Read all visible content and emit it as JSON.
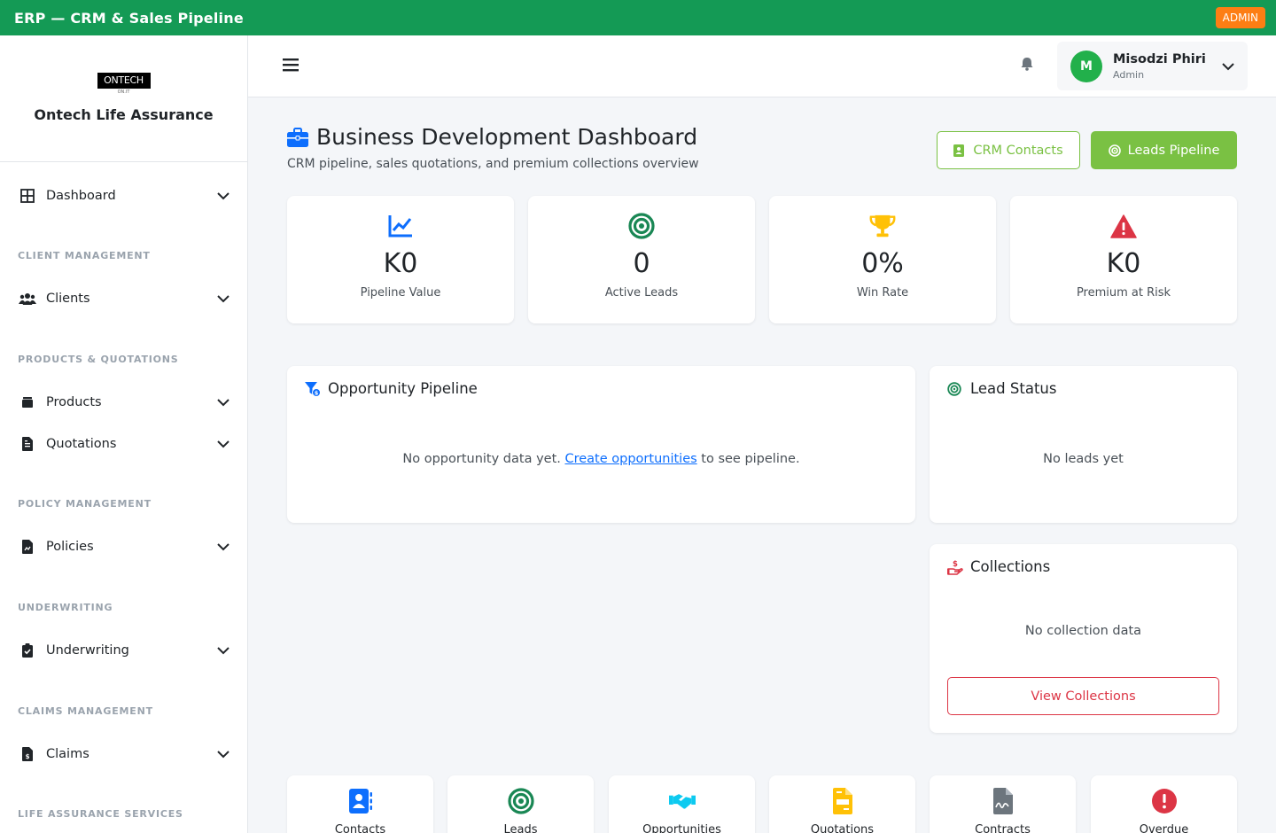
{
  "topbar": {
    "title": "ERP — CRM & Sales Pipeline",
    "badge": "ADMIN"
  },
  "sidebar": {
    "logo_text": "ONTECH",
    "logo_sub": "ON.IT",
    "company": "Ontech Life Assurance",
    "items": [
      {
        "label": "Dashboard",
        "icon": "grid-icon"
      },
      {
        "label": "Clients",
        "icon": "users-icon"
      },
      {
        "label": "Products",
        "icon": "box-icon"
      },
      {
        "label": "Quotations",
        "icon": "document-icon"
      },
      {
        "label": "Policies",
        "icon": "policy-file-icon"
      },
      {
        "label": "Underwriting",
        "icon": "clipboard-check-icon"
      },
      {
        "label": "Claims",
        "icon": "invoice-icon"
      }
    ],
    "sections": [
      "CLIENT MANAGEMENT",
      "PRODUCTS & QUOTATIONS",
      "POLICY MANAGEMENT",
      "UNDERWRITING",
      "CLAIMS MANAGEMENT",
      "LIFE ASSURANCE SERVICES"
    ]
  },
  "header": {
    "user": {
      "initial": "M",
      "name": "Misodzi Phiri",
      "role": "Admin"
    }
  },
  "main": {
    "title": "Business Development Dashboard",
    "subtitle": "CRM pipeline, sales quotations, and premium collections overview",
    "buttons": {
      "crm_contacts": "CRM Contacts",
      "leads_pipeline": "Leads Pipeline"
    },
    "stats": [
      {
        "value": "K0",
        "label": "Pipeline Value",
        "icon": "chart-line-icon",
        "color": "#0d6efd"
      },
      {
        "value": "0",
        "label": "Active Leads",
        "icon": "target-icon",
        "color": "#198754"
      },
      {
        "value": "0%",
        "label": "Win Rate",
        "icon": "trophy-icon",
        "color": "#ffc107"
      },
      {
        "value": "K0",
        "label": "Premium at Risk",
        "icon": "warning-icon",
        "color": "#dc3545"
      }
    ],
    "opportunity": {
      "title": "Opportunity Pipeline",
      "empty_prefix": "No opportunity data yet.",
      "empty_link": "Create opportunities",
      "empty_suffix": "to see pipeline."
    },
    "lead_status": {
      "title": "Lead Status",
      "empty": "No leads yet"
    },
    "collections": {
      "title": "Collections",
      "empty": "No collection data",
      "button": "View Collections"
    },
    "quick_links": [
      {
        "label": "Contacts",
        "icon": "contact-book-icon",
        "color": "#0d6efd"
      },
      {
        "label": "Leads",
        "icon": "target-icon",
        "color": "#198754"
      },
      {
        "label": "Opportunities",
        "icon": "handshake-icon",
        "color": "#0dcaf0"
      },
      {
        "label": "Quotations",
        "icon": "file-invoice-icon",
        "color": "#ffc107"
      },
      {
        "label": "Contracts",
        "icon": "file-signature-icon",
        "color": "#6c757d"
      },
      {
        "label": "Overdue",
        "icon": "exclamation-circle-icon",
        "color": "#dc3545"
      }
    ]
  }
}
